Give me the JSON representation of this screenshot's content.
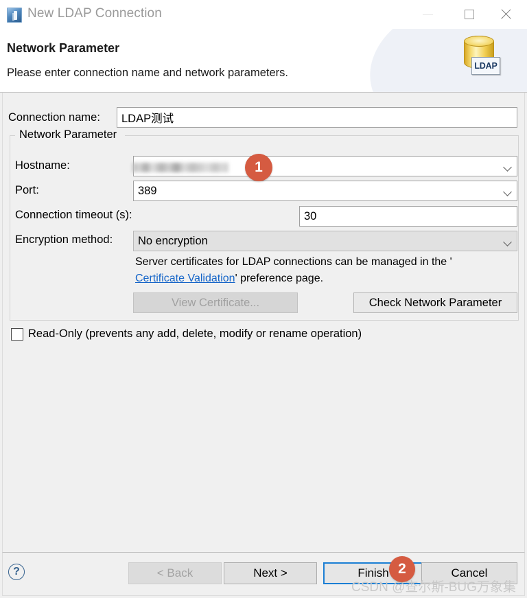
{
  "window": {
    "title": "New LDAP Connection",
    "app_icon": "ldap-app-icon",
    "minimize_label": "—",
    "maximize_label": "☐",
    "close_label": "✕"
  },
  "banner": {
    "title": "Network Parameter",
    "subtitle": "Please enter connection name and network parameters.",
    "logo_text": "LDAP"
  },
  "form": {
    "connection_name_label": "Connection name:",
    "connection_name_value": "LDAP测试",
    "group_title": "Network Parameter",
    "hostname_label": "Hostname:",
    "hostname_value": "",
    "port_label": "Port:",
    "port_value": "389",
    "timeout_label": "Connection timeout (s):",
    "timeout_value": "30",
    "encryption_label": "Encryption method:",
    "encryption_value": "No encryption",
    "cert_info_line1": "Server certificates for LDAP connections can be managed in the '",
    "cert_info_link": "Certificate Validation",
    "cert_info_line2": "' preference page.",
    "view_certificate_label": "View Certificate...",
    "check_network_label": "Check Network Parameter",
    "readonly_label": "Read-Only (prevents any add, delete, modify or rename operation)",
    "readonly_checked": false
  },
  "footer": {
    "help_label": "?",
    "back_label": "< Back",
    "next_label": "Next >",
    "finish_label": "Finish",
    "cancel_label": "Cancel"
  },
  "annotations": {
    "badge1": "1",
    "badge2": "2",
    "color": "#d55b41"
  },
  "watermark": "CSDN @查尔斯-BUG万象集"
}
